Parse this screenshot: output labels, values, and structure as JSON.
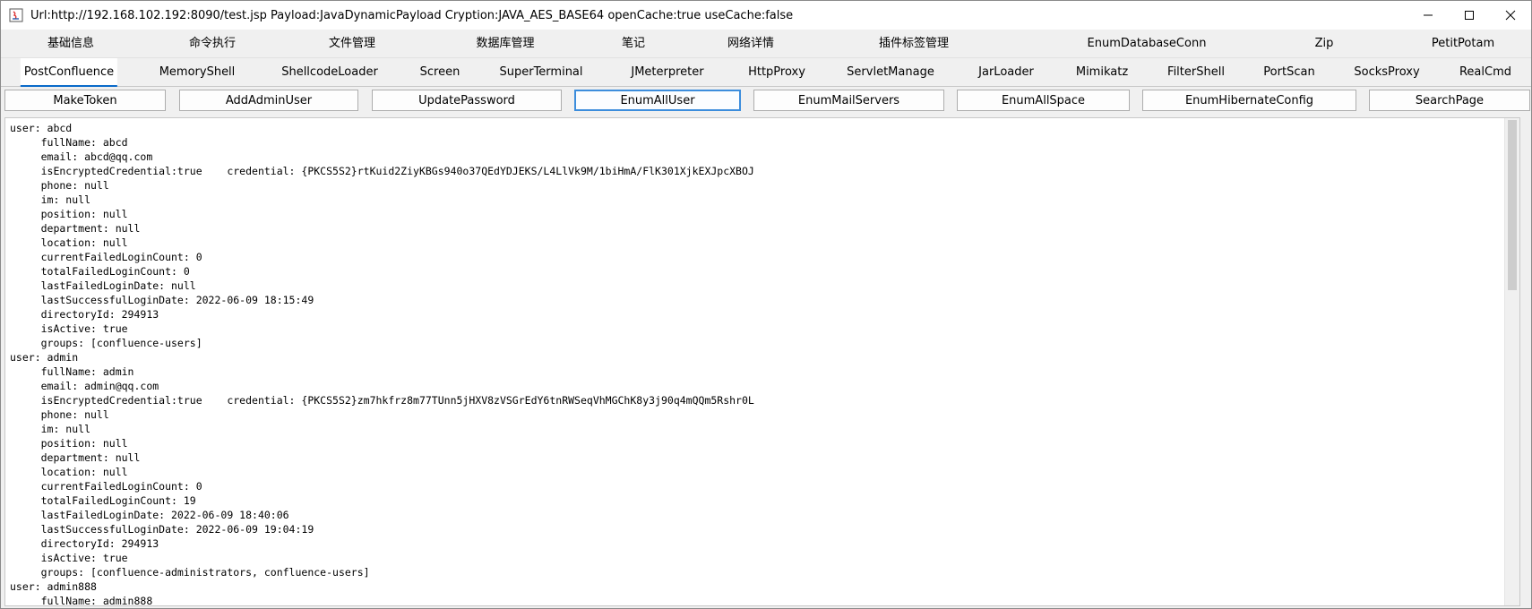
{
  "window": {
    "title": "Url:http://192.168.102.192:8090/test.jsp Payload:JavaDynamicPayload Cryption:JAVA_AES_BASE64 openCache:true useCache:false",
    "controls": {
      "minimize": "—",
      "maximize": "☐",
      "close": "✕"
    }
  },
  "tabs_row1": [
    "基础信息",
    "命令执行",
    "文件管理",
    "数据库管理",
    "笔记",
    "网络详情",
    "插件标签管理",
    "EnumDatabaseConn",
    "Zip",
    "PetitPotam"
  ],
  "tabs_row2": [
    "PostConfluence",
    "MemoryShell",
    "ShellcodeLoader",
    "Screen",
    "SuperTerminal",
    "JMeterpreter",
    "HttpProxy",
    "ServletManage",
    "JarLoader",
    "Mimikatz",
    "FilterShell",
    "PortScan",
    "SocksProxy",
    "RealCmd"
  ],
  "selected_tab": "PostConfluence",
  "toolbar": {
    "buttons": [
      "MakeToken",
      "AddAdminUser",
      "UpdatePassword",
      "EnumAllUser",
      "EnumMailServers",
      "EnumAllSpace",
      "EnumHibernateConfig",
      "SearchPage"
    ],
    "focused": "EnumAllUser"
  },
  "output_lines": [
    "user: abcd",
    "     fullName: abcd",
    "     email: abcd@qq.com",
    "     isEncryptedCredential:true    credential: {PKCS5S2}rtKuid2ZiyKBGs940o37QEdYDJEKS/L4LlVk9M/1biHmA/FlK301XjkEXJpcXBOJ",
    "     phone: null",
    "     im: null",
    "     position: null",
    "     department: null",
    "     location: null",
    "     currentFailedLoginCount: 0",
    "     totalFailedLoginCount: 0",
    "     lastFailedLoginDate: null",
    "     lastSuccessfulLoginDate: 2022-06-09 18:15:49",
    "     directoryId: 294913",
    "     isActive: true",
    "     groups: [confluence-users]",
    "user: admin",
    "     fullName: admin",
    "     email: admin@qq.com",
    "     isEncryptedCredential:true    credential: {PKCS5S2}zm7hkfrz8m77TUnn5jHXV8zVSGrEdY6tnRWSeqVhMGChK8y3j90q4mQQm5Rshr0L",
    "     phone: null",
    "     im: null",
    "     position: null",
    "     department: null",
    "     location: null",
    "     currentFailedLoginCount: 0",
    "     totalFailedLoginCount: 19",
    "     lastFailedLoginDate: 2022-06-09 18:40:06",
    "     lastSuccessfulLoginDate: 2022-06-09 19:04:19",
    "     directoryId: 294913",
    "     isActive: true",
    "     groups: [confluence-administrators, confluence-users]",
    "user: admin888",
    "     fullName: admin888"
  ]
}
